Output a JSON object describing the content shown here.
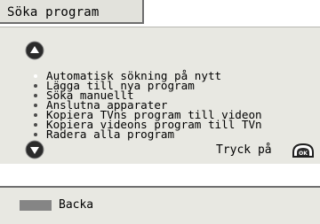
{
  "header": {
    "title": "Söka program"
  },
  "menu": {
    "items": [
      {
        "label": "Automatisk sökning på nytt",
        "selected": true
      },
      {
        "label": "Lägga till nya program",
        "selected": false
      },
      {
        "label": "Söka manuellt",
        "selected": false
      },
      {
        "label": "Anslutna apparater",
        "selected": false
      },
      {
        "label": "Kopiera TVns program till videon",
        "selected": false
      },
      {
        "label": "Kopiera videons program till TVn",
        "selected": false
      },
      {
        "label": "Radera alla program",
        "selected": false
      }
    ]
  },
  "hint": {
    "text": "Tryck på",
    "key_label": "OK"
  },
  "footer": {
    "back_label": "Backa"
  },
  "icons": {
    "up": "arrow-up-icon",
    "down": "arrow-down-icon",
    "ok": "ok-key-icon"
  },
  "colors": {
    "panel_bg": "#e8e8e2",
    "button_dark": "#2b2b2b",
    "back_key": "#858585"
  }
}
